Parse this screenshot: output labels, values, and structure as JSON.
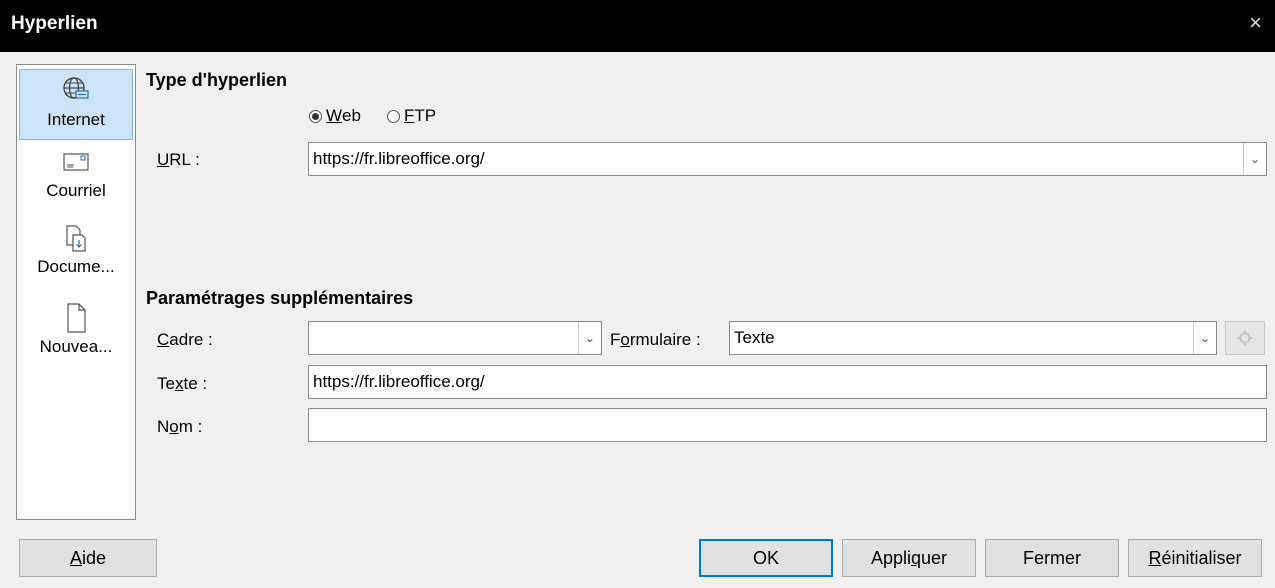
{
  "window": {
    "title": "Hyperlien",
    "close_glyph": "×"
  },
  "sidebar": {
    "items": [
      {
        "label": "Internet",
        "icon": "globe-icon",
        "selected": true
      },
      {
        "label": "Courriel",
        "icon": "mail-icon",
        "selected": false
      },
      {
        "label": "Docume...",
        "icon": "document-icon",
        "selected": false
      },
      {
        "label": "Nouvea...",
        "icon": "new-document-icon",
        "selected": false
      }
    ]
  },
  "hyperlink_type": {
    "heading": "Type d'hyperlien",
    "radio_web": {
      "prefix": "",
      "accel": "W",
      "rest": "eb",
      "checked": true
    },
    "radio_ftp": {
      "prefix": "",
      "accel": "F",
      "rest": "TP",
      "checked": false
    },
    "url": {
      "label_accel": "U",
      "label_rest": "RL :",
      "value": "https://fr.libreoffice.org/"
    }
  },
  "further_settings": {
    "heading": "Paramétrages supplémentaires",
    "frame": {
      "label_accel": "C",
      "label_rest": "adre :",
      "value": ""
    },
    "form": {
      "label_pre": "F",
      "label_accel": "o",
      "label_rest": "rmulaire :",
      "value": "Texte"
    },
    "text": {
      "label_pre": "Te",
      "label_accel": "x",
      "label_rest": "te :",
      "value": "https://fr.libreoffice.org/"
    },
    "name": {
      "label_pre": "N",
      "label_accel": "o",
      "label_rest": "m :",
      "value": ""
    }
  },
  "buttons": {
    "help": {
      "accel": "A",
      "rest": "ide"
    },
    "ok": {
      "label": "OK"
    },
    "apply": {
      "pre": "Appli",
      "accel": "q",
      "rest": "uer"
    },
    "close": {
      "label": "Fermer"
    },
    "reset": {
      "accel": "R",
      "rest": "éinitialiser"
    }
  }
}
